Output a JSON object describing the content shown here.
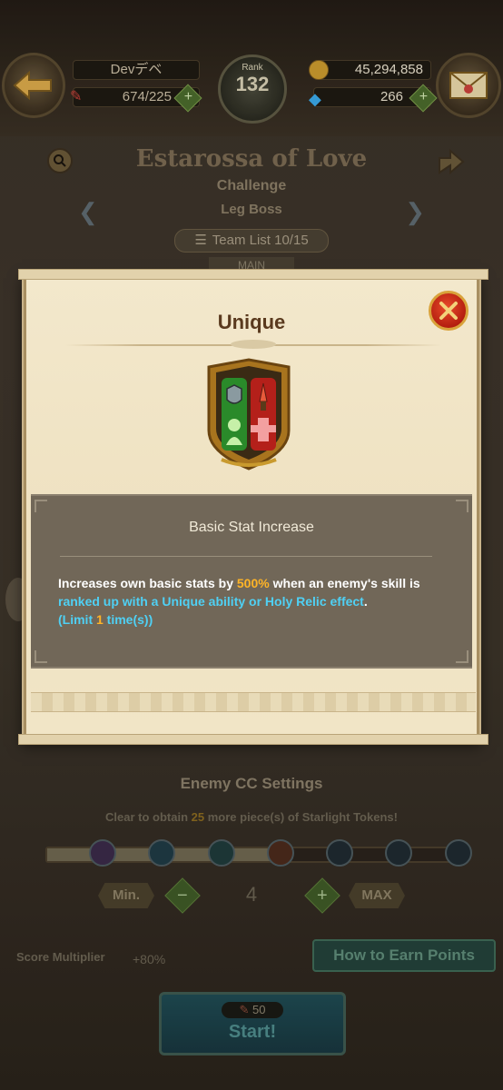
{
  "header": {
    "player_name": "Devデベ",
    "stamina": "674/225",
    "rank_label": "Rank",
    "rank_value": "132",
    "gold": "45,294,858",
    "gems": "266"
  },
  "stage": {
    "title": "Estarossa of Love",
    "difficulty": "Challenge",
    "boss": "Leg Boss",
    "team_list": "Team List 10/15",
    "main_tag": "MAIN"
  },
  "modal": {
    "title": "Unique",
    "skill_name": "Basic Stat Increase",
    "desc_part1": "Increases own basic stats by ",
    "desc_pct": "500%",
    "desc_part2": " when an enemy's skill is",
    "desc_line2": "ranked up with a Unique ability or Holy Relic effect",
    "desc_period": ".",
    "limit_prefix": "(Limit ",
    "limit_num": "1",
    "limit_suffix": " time(s))",
    "colors": {
      "highlight_orange": "#ffb427",
      "highlight_blue": "#4fd0f4",
      "close_red": "#d32a18"
    }
  },
  "enemy_cc": {
    "title": "Enemy CC Settings",
    "reward_prefix": "Clear to obtain ",
    "reward_num": "25",
    "reward_suffix": " more piece(s) of Starlight Tokens!",
    "min_label": "Min.",
    "max_label": "MAX",
    "value": "4",
    "filled_fraction": 0.55
  },
  "score": {
    "label": "Score Multiplier",
    "value": "+80%",
    "earn_button": "How to Earn Points"
  },
  "start": {
    "cost": "50",
    "label": "Start!"
  },
  "icons": [
    "back-arrow-icon",
    "mail-icon",
    "gold-coin-icon",
    "gem-icon",
    "search-icon",
    "share-icon",
    "close-icon",
    "unique-emblem-icon",
    "team-list-icon",
    "stamina-icon"
  ]
}
